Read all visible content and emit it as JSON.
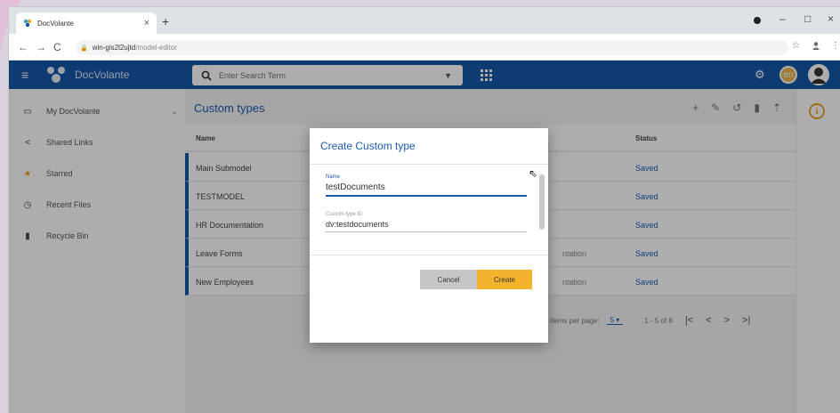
{
  "browser": {
    "tab_title": "DocVolante",
    "tab_close": "×",
    "new_tab": "+",
    "window": {
      "minimize": "–",
      "restore": "□",
      "close": "×"
    },
    "url_host": "win-gis2l2ujtd",
    "url_path": "/model-editor"
  },
  "header": {
    "brand": "DocVolante",
    "search_placeholder": "Enter Search Term",
    "lang": "en"
  },
  "sidebar": {
    "items": [
      {
        "label": "My DocVolante",
        "icon": "laptop-icon"
      },
      {
        "label": "Shared Links",
        "icon": "share-icon"
      },
      {
        "label": "Starred",
        "icon": "star-icon"
      },
      {
        "label": "Recent Files",
        "icon": "clock-icon"
      },
      {
        "label": "Recycle Bin",
        "icon": "trash-icon"
      }
    ]
  },
  "main": {
    "title": "Custom types",
    "columns": {
      "name": "Name",
      "status": "Status"
    },
    "rows": [
      {
        "name": "Main Submodel",
        "desc": "",
        "status": "Saved"
      },
      {
        "name": "TESTMODEL",
        "desc": "",
        "status": "Saved"
      },
      {
        "name": "HR Documentation",
        "desc": "",
        "status": "Saved"
      },
      {
        "name": "Leave Forms",
        "desc": "ntation",
        "status": "Saved"
      },
      {
        "name": "New Employees",
        "desc": "ntation",
        "status": "Saved"
      }
    ],
    "paging": {
      "items_label": "Items per page:",
      "items_value": "5",
      "range": "1 - 5 of 8"
    }
  },
  "dialog": {
    "title": "Create Custom type",
    "name_label": "Name",
    "name_value": "testDocuments",
    "id_label": "Custom type ID",
    "id_value": "dv:testdocuments",
    "cancel": "Cancel",
    "create": "Create"
  },
  "colors": {
    "primary": "#1557a8",
    "accent": "#f3b32c",
    "link": "#1e5bb0"
  }
}
